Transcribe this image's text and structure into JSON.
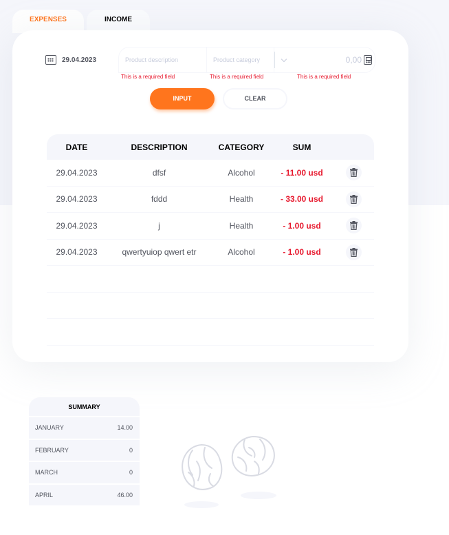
{
  "tabs": {
    "expenses": "EXPENSES",
    "income": "INCOME"
  },
  "form": {
    "date": "29.04.2023",
    "description_placeholder": "Product description",
    "category_placeholder": "Product category",
    "sum_placeholder": "0,00",
    "required_text": "This is a required field",
    "input_label": "INPUT",
    "clear_label": "CLEAR"
  },
  "table": {
    "headers": [
      "DATE",
      "DESCRIPTION",
      "CATEGORY",
      "SUM"
    ],
    "rows": [
      {
        "date": "29.04.2023",
        "description": "dfsf",
        "category": "Alcohol",
        "sum": "- 11.00 usd"
      },
      {
        "date": "29.04.2023",
        "description": "fddd",
        "category": "Health",
        "sum": "- 33.00 usd"
      },
      {
        "date": "29.04.2023",
        "description": "j",
        "category": "Health",
        "sum": "- 1.00 usd"
      },
      {
        "date": "29.04.2023",
        "description": "qwertyuiop qwert etr",
        "category": "Alcohol",
        "sum": "- 1.00 usd"
      }
    ]
  },
  "summary": {
    "title": "SUMMARY",
    "months": [
      {
        "month": "JANUARY",
        "value": "14.00"
      },
      {
        "month": "FEBRUARY",
        "value": "0"
      },
      {
        "month": "MARCH",
        "value": "0"
      },
      {
        "month": "APRIL",
        "value": "46.00"
      }
    ]
  },
  "colors": {
    "accent": "#ff751d",
    "negative": "#e7192e",
    "muted": "#f5f6fb"
  },
  "icons": [
    "calendar-icon",
    "chevron-down-icon",
    "calculator-icon",
    "trash-icon",
    "cabbage-illustration"
  ]
}
